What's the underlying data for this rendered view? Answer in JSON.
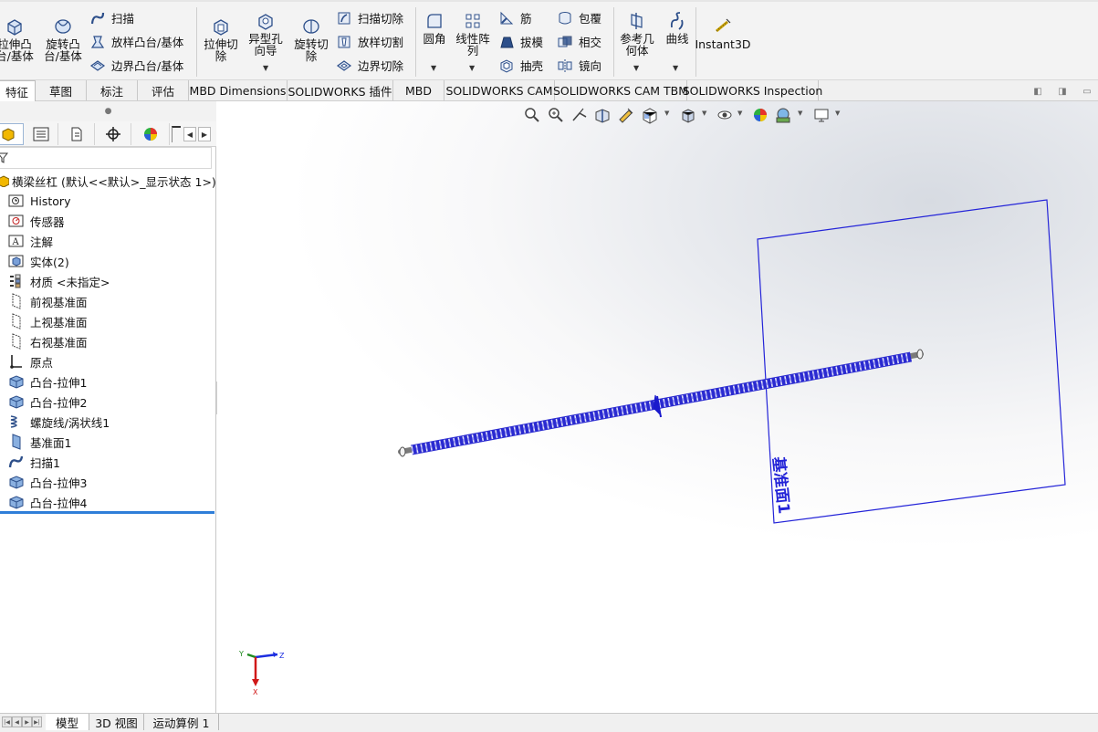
{
  "ribbon": {
    "extrude_boss": "拉伸凸\n台/基体",
    "revolve_boss": "旋转凸\n台/基体",
    "sweep": "扫描",
    "loft_boss": "放样凸台/基体",
    "boundary_boss": "边界凸台/基体",
    "extrude_cut": "拉伸切\n除",
    "hole_wizard": "异型孔\n向导",
    "revolve_cut": "旋转切\n除",
    "swept_cut": "扫描切除",
    "lofted_cut": "放样切割",
    "boundary_cut": "边界切除",
    "fillet": "圆角",
    "linear_pattern": "线性阵\n列",
    "rib": "筋",
    "draft": "拔模",
    "shell": "抽壳",
    "wrap": "包覆",
    "intersect": "相交",
    "mirror": "镜向",
    "reference_geometry": "参考几\n何体",
    "curves": "曲线",
    "instant3d": "Instant3D"
  },
  "tabs": [
    "特征",
    "草图",
    "标注",
    "评估",
    "MBD Dimensions",
    "SOLIDWORKS 插件",
    "MBD",
    "SOLIDWORKS CAM",
    "SOLIDWORKS CAM TBM",
    "SOLIDWORKS Inspection"
  ],
  "tree": {
    "root": "横梁丝杠 (默认<<默认>_显示状态 1>)",
    "items": [
      {
        "label": "History",
        "icon": "history-icon"
      },
      {
        "label": "传感器",
        "icon": "sensor-icon"
      },
      {
        "label": "注解",
        "icon": "annotation-icon"
      },
      {
        "label": "实体(2)",
        "icon": "solid-bodies-icon"
      },
      {
        "label": "材质 <未指定>",
        "icon": "material-icon"
      },
      {
        "label": "前视基准面",
        "icon": "plane-icon"
      },
      {
        "label": "上视基准面",
        "icon": "plane-icon"
      },
      {
        "label": "右视基准面",
        "icon": "plane-icon"
      },
      {
        "label": "原点",
        "icon": "origin-icon"
      },
      {
        "label": "凸台-拉伸1",
        "icon": "extrude-icon"
      },
      {
        "label": "凸台-拉伸2",
        "icon": "extrude-icon"
      },
      {
        "label": "螺旋线/涡状线1",
        "icon": "helix-icon"
      },
      {
        "label": "基准面1",
        "icon": "plane-feature-icon"
      },
      {
        "label": "扫描1",
        "icon": "sweep-icon"
      },
      {
        "label": "凸台-拉伸3",
        "icon": "extrude-icon"
      },
      {
        "label": "凸台-拉伸4",
        "icon": "extrude-icon"
      }
    ]
  },
  "viewport": {
    "plane_label": "基准面1",
    "triad": {
      "x": "X",
      "y": "Y",
      "z": "Z"
    }
  },
  "bottom_tabs": [
    "模型",
    "3D 视图",
    "运动算例 1"
  ],
  "colors": {
    "accent": "#2f7ed8",
    "plane": "#2424d8",
    "thread": "#2a2ad0"
  }
}
